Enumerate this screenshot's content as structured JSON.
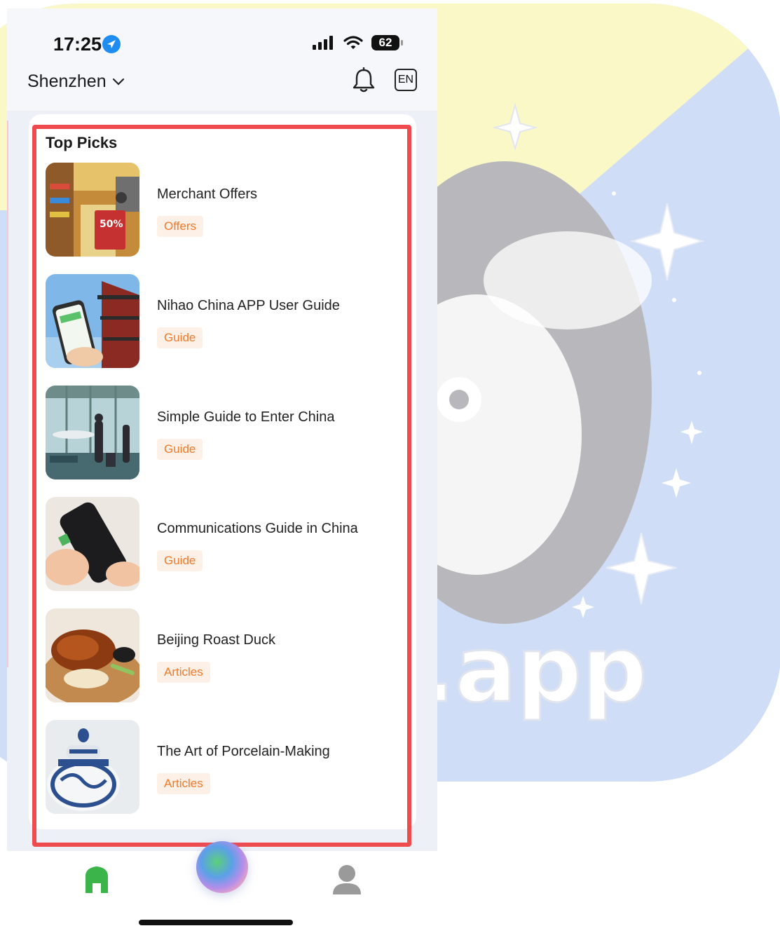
{
  "status_bar": {
    "time": "17:25",
    "battery": "62"
  },
  "header": {
    "city": "Shenzhen",
    "language": "EN"
  },
  "top_picks": {
    "title": "Top Picks",
    "items": [
      {
        "title": "Merchant Offers",
        "tag": "Offers",
        "image": "store-interior",
        "badge": "50%"
      },
      {
        "title": "Nihao China APP User Guide",
        "tag": "Guide",
        "image": "phone-and-pagoda"
      },
      {
        "title": "Simple Guide to Enter China",
        "tag": "Guide",
        "image": "airport-terminal"
      },
      {
        "title": "Communications Guide in China",
        "tag": "Guide",
        "image": "hand-with-phone-and-sim"
      },
      {
        "title": "Beijing Roast Duck",
        "tag": "Articles",
        "image": "roast-duck-plate"
      },
      {
        "title": "The Art of Porcelain-Making",
        "tag": "Articles",
        "image": "blue-white-porcelain-jar"
      }
    ]
  },
  "tabbar": {
    "home_icon": "home-icon",
    "ai_icon": "ai-orb-icon",
    "profile_icon": "profile-icon"
  },
  "background": {
    "watermark_text": ".app"
  },
  "colors": {
    "accent_green": "#3bb44a",
    "tag_orange": "#f07a2a",
    "tag_bg": "#fdf0e6",
    "highlight_red": "#ef4b4f"
  }
}
